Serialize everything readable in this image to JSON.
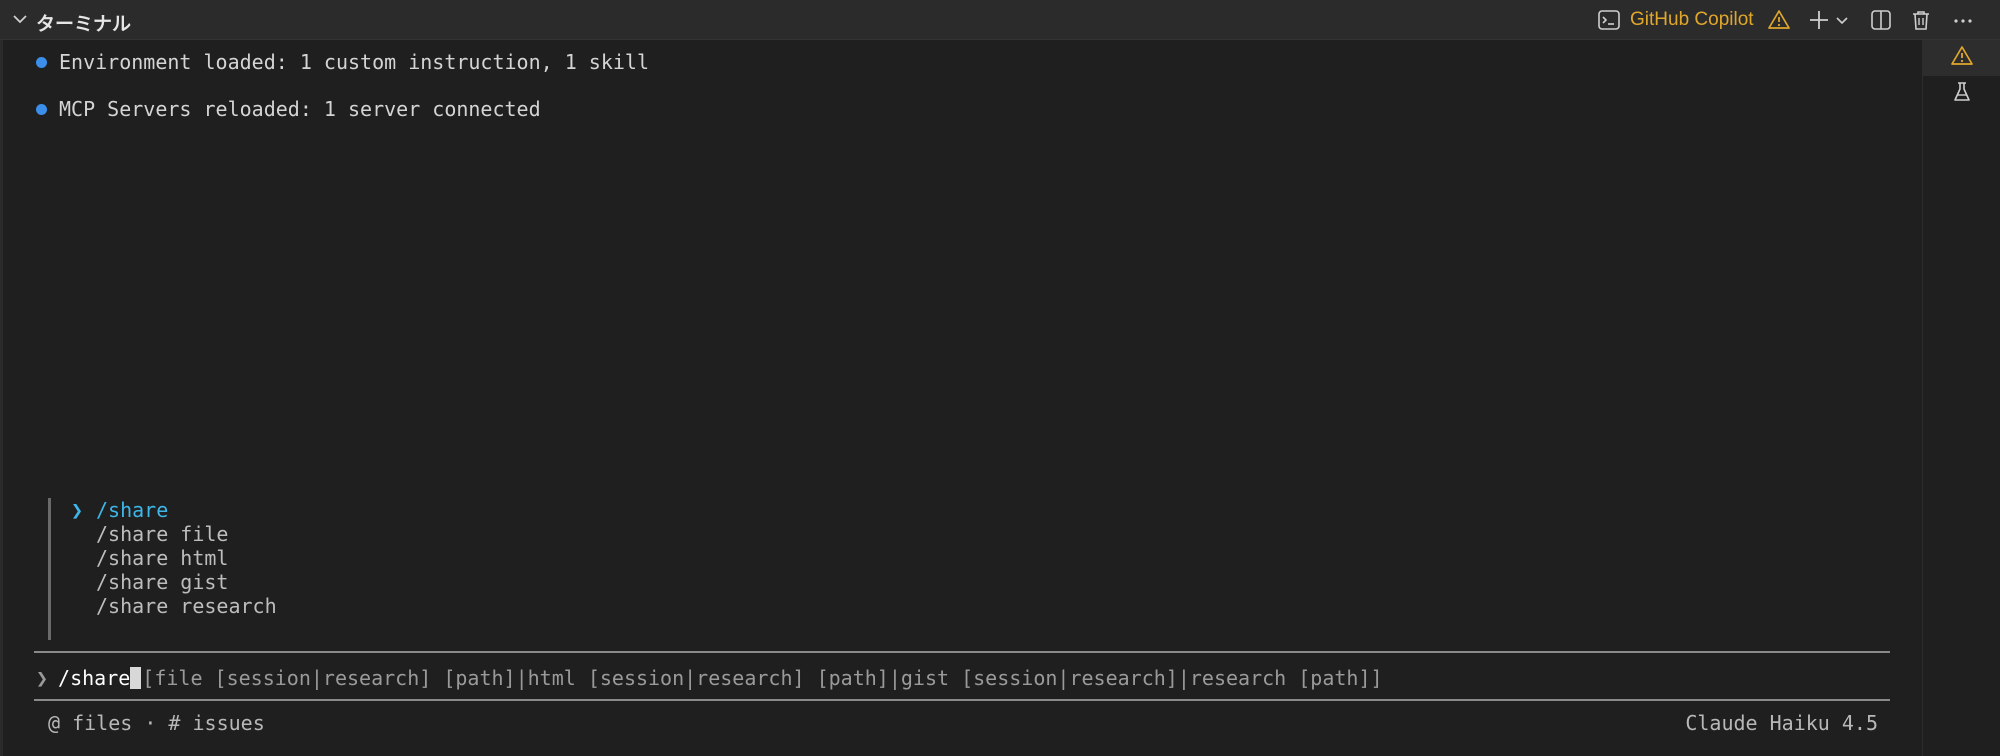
{
  "panel": {
    "title": "ターミナル",
    "copilot_label": "GitHub Copilot"
  },
  "icons": {
    "collapse": "chevron-down-icon",
    "terminal_profile": "terminal-icon",
    "warning": "warning-icon",
    "new_terminal": "plus-icon",
    "dropdown": "chevron-down-icon",
    "split": "split-icon",
    "delete": "trash-icon",
    "more": "ellipsis-icon",
    "rail_warning": "warning-icon",
    "rail_test": "beaker-icon"
  },
  "colors": {
    "accent_blue": "#3b8eea",
    "suggestion_active": "#3fb6e8",
    "warning_yellow": "#e0a72b"
  },
  "terminal": {
    "messages": [
      "Environment loaded: 1 custom instruction, 1 skill",
      "MCP Servers reloaded: 1 server connected"
    ],
    "suggestions": {
      "caret": "❯",
      "items": [
        "/share",
        "/share file",
        "/share html",
        "/share gist",
        "/share research"
      ]
    },
    "input": {
      "prompt": "❯",
      "command": "/share",
      "hint": "[file [session|research] [path]|html [session|research] [path]|gist [session|research]|research [path]]"
    },
    "footer": {
      "left": "@ files · # issues",
      "model": "Claude Haiku 4.5"
    }
  }
}
